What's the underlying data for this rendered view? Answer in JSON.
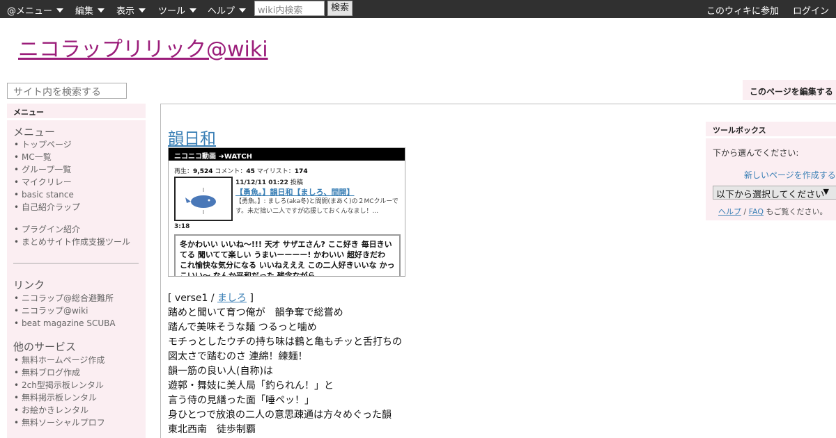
{
  "topbar": {
    "menus": [
      "@メニュー",
      "編集",
      "表示",
      "ツール",
      "ヘルプ"
    ],
    "search_placeholder": "wiki内検索",
    "search_button": "検索",
    "join": "このウィキに参加",
    "login": "ログイン"
  },
  "site": {
    "title": "ニコラップリリック@wiki",
    "search_placeholder": "サイト内を検索する",
    "edit_button": "このページを編集する"
  },
  "sidebar": {
    "header": "メニュー",
    "menu_title": "メニュー",
    "menu_items": [
      "トップページ",
      "MC一覧",
      "グループ一覧",
      "マイクリレー",
      "basic stance",
      "自己紹介ラップ"
    ],
    "menu_items2": [
      "プラグイン紹介",
      "まとめサイト作成支援ツール"
    ],
    "links_title": "リンク",
    "links": [
      "ニコラップ@総合避難所",
      "ニコラップ@wiki",
      "beat magazine SCUBA"
    ],
    "services_title": "他のサービス",
    "services": [
      "無料ホームページ作成",
      "無料ブログ作成",
      "2ch型掲示板レンタル",
      "無料掲示板レンタル",
      "お絵かきレンタル",
      "無料ソーシャルプロフ"
    ]
  },
  "page": {
    "title": "韻日和",
    "video": {
      "bar": "ニコニコ動画 ➜WATCH",
      "plays_label": "再生：",
      "plays": "9,524",
      "comments_label": "コメント：",
      "comments": "45",
      "mylist_label": "マイリスト：",
      "mylist": "174",
      "date": "11/12/11 01:22",
      "date_suffix": "投稿",
      "title": "【勇魚。】韻日和【ましろ、間開】",
      "description": "【勇魚。】: ましろ(aka冬)と間開(まあく)の２MCクルーです。未だ拙い二人ですが応援しておくんなまし！...",
      "duration": "3:18",
      "comment_text": "冬かわいい いいね〜!!! 天才 サザエさん? ここ好き 毎日きいてる 聞いてて楽しい うまいーーーー! かわいい 超好きだわ これ愉快な気分になる いいねえええ この二人好きいいな かっこいい〜 なんか平和だった 残念ながら"
    },
    "lyrics": {
      "verse_prefix": "[ verse1 / ",
      "verse_link": "ましろ",
      "verse_suffix": " ]",
      "lines": [
        "踏めと聞いて育つ俺が　韻争奪で総嘗め",
        "踏んで美味そうな麺 つるっと噛め",
        "モチっとしたウチの持ち味は鶴と亀もチッと舌打ちの",
        "図太さで踏むのさ 連綿！練麺！",
        "韻一筋の良い人(自称)は",
        "遊郭・舞妓に美人局「釣られん！」と",
        "言う侍の見繕った面「唾ペッ！」",
        "身ひとつで放浪の二人の意思疎通は方々めぐった韻",
        "東北西南　徒歩制覇"
      ]
    }
  },
  "toolbox": {
    "header": "ツールボックス",
    "label": "下から選んでください:",
    "new_page": "新しいページを作成する",
    "select": "以下から選択してください",
    "help": "ヘルプ",
    "sep": " / ",
    "faq": "FAQ",
    "help_suffix": " もご覧ください。"
  }
}
